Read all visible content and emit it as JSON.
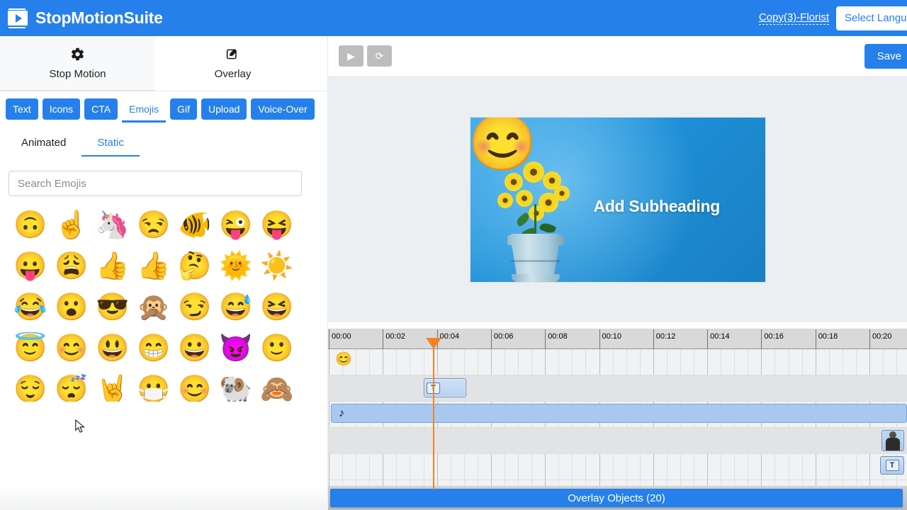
{
  "app": {
    "brand": "StopMotionSuite",
    "logo_icon": "film-play-icon",
    "project_name": "Copy(3)-Florist",
    "language_select": "Select Language"
  },
  "mode_tabs": [
    {
      "label": "Stop Motion",
      "icon": "gear-icon",
      "active": false
    },
    {
      "label": "Overlay",
      "icon": "pencil-square-icon",
      "active": true
    }
  ],
  "categories": [
    {
      "label": "Text",
      "active": false
    },
    {
      "label": "Icons",
      "active": false
    },
    {
      "label": "CTA",
      "active": false
    },
    {
      "label": "Emojis",
      "active": true
    },
    {
      "label": "Gif",
      "active": false
    },
    {
      "label": "Upload",
      "active": false
    },
    {
      "label": "Voice-Over",
      "active": false
    }
  ],
  "sub_tabs": [
    {
      "label": "Animated",
      "active": false
    },
    {
      "label": "Static",
      "active": true
    }
  ],
  "search": {
    "placeholder": "Search Emojis",
    "value": "",
    "icon": "search-icon"
  },
  "emojis": [
    {
      "name": "upside-down-face",
      "glyph": "🙃"
    },
    {
      "name": "index-pointing-up",
      "glyph": "☝️"
    },
    {
      "name": "unicorn",
      "glyph": "🦄"
    },
    {
      "name": "unamused-face",
      "glyph": "😒"
    },
    {
      "name": "tropical-fish",
      "glyph": "🐠"
    },
    {
      "name": "winking-face-with-tongue",
      "glyph": "😜"
    },
    {
      "name": "squinting-face-with-tongue",
      "glyph": "😝"
    },
    {
      "name": "face-with-tongue",
      "glyph": "😛"
    },
    {
      "name": "weary-face",
      "glyph": "😩"
    },
    {
      "name": "thumbs-up",
      "glyph": "👍"
    },
    {
      "name": "thumbs-up-2",
      "glyph": "👍"
    },
    {
      "name": "thinking-face",
      "glyph": "🤔"
    },
    {
      "name": "sun-with-face",
      "glyph": "🌞"
    },
    {
      "name": "sun",
      "glyph": "☀️"
    },
    {
      "name": "face-with-tears-of-joy",
      "glyph": "😂"
    },
    {
      "name": "face-with-open-mouth",
      "glyph": "😮"
    },
    {
      "name": "smiling-face-with-sunglasses",
      "glyph": "😎"
    },
    {
      "name": "speak-no-evil-monkey",
      "glyph": "🙊"
    },
    {
      "name": "smirking-face",
      "glyph": "😏"
    },
    {
      "name": "grinning-face-with-sweat",
      "glyph": "😅"
    },
    {
      "name": "grinning-squinting-face",
      "glyph": "😆"
    },
    {
      "name": "smiling-face-with-halo",
      "glyph": "😇"
    },
    {
      "name": "smiling-face-with-smiling-eyes",
      "glyph": "😊"
    },
    {
      "name": "grinning-face-with-big-eyes",
      "glyph": "😃"
    },
    {
      "name": "beaming-face-with-smiling-eyes",
      "glyph": "😁"
    },
    {
      "name": "grinning-face",
      "glyph": "😀"
    },
    {
      "name": "smiling-face-with-horns",
      "glyph": "😈"
    },
    {
      "name": "slightly-smiling-face",
      "glyph": "🙂"
    },
    {
      "name": "relieved-face",
      "glyph": "😌"
    },
    {
      "name": "sleeping-face",
      "glyph": "😴"
    },
    {
      "name": "sign-of-the-horns",
      "glyph": "🤘"
    },
    {
      "name": "face-with-medical-mask",
      "glyph": "😷"
    },
    {
      "name": "flushed-face",
      "glyph": "😊"
    },
    {
      "name": "ram",
      "glyph": "🐏"
    },
    {
      "name": "see-no-evil-monkey",
      "glyph": "🙈"
    }
  ],
  "editor_toolbar": {
    "play_label": "▶",
    "reset_label": "⟳",
    "save_label": "Save"
  },
  "stage": {
    "subheading": "Add Subheading",
    "overlay_emoji": "😊",
    "background_description": "potted yellow flowers on blue backdrop"
  },
  "timeline": {
    "ticks": [
      "00:00",
      "00:02",
      "00:04",
      "00:06",
      "00:08",
      "00:10",
      "00:12",
      "00:14",
      "00:16",
      "00:18",
      "00:20"
    ],
    "playhead_time": "00:03",
    "tracks": [
      {
        "name": "emoji-track",
        "item_glyph": "😊"
      },
      {
        "name": "text-track",
        "clip_icon": "text-clip-icon"
      },
      {
        "name": "audio-track",
        "clip_icon": "♪"
      },
      {
        "name": "media-track-1",
        "clip_icon": "person-thumbnail"
      },
      {
        "name": "media-track-2",
        "clip_icon": "text-clip-icon"
      }
    ],
    "overlay_objects_label": "Overlay Objects (20)"
  },
  "colors": {
    "brand_blue": "#2680eb",
    "playhead_orange": "#f58220",
    "ruler_gray": "#d9d9d9",
    "audio_clip_blue": "#a8c8f0"
  }
}
